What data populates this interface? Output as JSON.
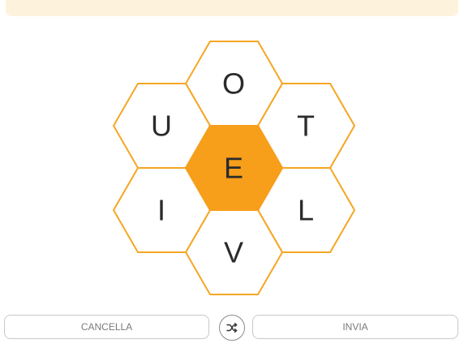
{
  "colors": {
    "center_fill": "#f79e1b",
    "outline": "#f5a623",
    "input_bar": "#fdf3dc"
  },
  "hive": {
    "center_letter": "E",
    "outer_letters": [
      "O",
      "T",
      "L",
      "V",
      "I",
      "U"
    ]
  },
  "buttons": {
    "delete_label": "CANCELLA",
    "enter_label": "INVIA",
    "shuffle_icon": "shuffle-icon"
  }
}
